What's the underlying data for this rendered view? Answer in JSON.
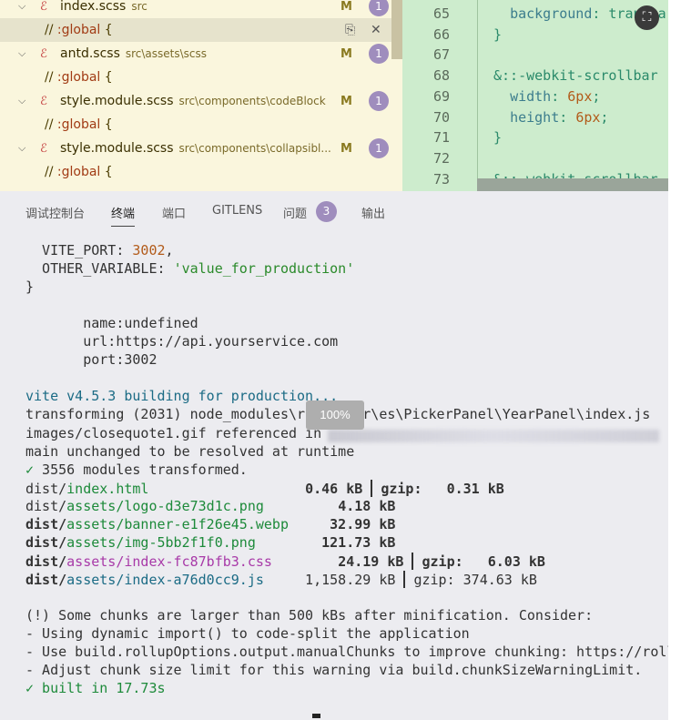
{
  "search_results": {
    "rows": [
      {
        "type": "file",
        "name": "index.scss",
        "path": "src",
        "badge": "M",
        "count": "1"
      },
      {
        "type": "match",
        "text": "// ",
        "highlight": ":global",
        "after": " {"
      },
      {
        "type": "file",
        "name": "antd.scss",
        "path": "src\\assets\\scss",
        "badge": "M",
        "count": "1"
      },
      {
        "type": "match",
        "text": "// ",
        "highlight": ":global",
        "after": " {"
      },
      {
        "type": "file",
        "name": "style.module.scss",
        "path": "src\\components\\codeBlock",
        "badge": "M",
        "count": "1"
      },
      {
        "type": "match",
        "text": "// ",
        "highlight": ":global",
        "after": " {"
      },
      {
        "type": "file",
        "name": "style.module.scss",
        "path": "src\\components\\collapsibl...",
        "badge": "M",
        "count": "1"
      },
      {
        "type": "match",
        "text": "// ",
        "highlight": ":global",
        "after": " {"
      }
    ],
    "icons": {
      "chevron": "chevron-down-icon",
      "file": "scss-file-icon",
      "replace": "replace-icon",
      "dismiss": "close-icon"
    }
  },
  "code_editor": {
    "lines": [
      {
        "num": "65",
        "parts": [
          {
            "t": "  "
          },
          {
            "t": "background",
            "c": "k"
          },
          {
            "t": ": transpa"
          }
        ]
      },
      {
        "num": "66",
        "parts": [
          {
            "t": "}"
          }
        ]
      },
      {
        "num": "67",
        "parts": [
          {
            "t": ""
          }
        ]
      },
      {
        "num": "68",
        "parts": [
          {
            "t": "&::-webkit-scrollbar "
          }
        ]
      },
      {
        "num": "69",
        "parts": [
          {
            "t": "  "
          },
          {
            "t": "width",
            "c": "k"
          },
          {
            "t": ": "
          },
          {
            "t": "6px",
            "c": "n"
          },
          {
            "t": ";"
          }
        ]
      },
      {
        "num": "70",
        "parts": [
          {
            "t": "  "
          },
          {
            "t": "height",
            "c": "k"
          },
          {
            "t": ": "
          },
          {
            "t": "6px",
            "c": "n"
          },
          {
            "t": ";"
          }
        ]
      },
      {
        "num": "71",
        "parts": [
          {
            "t": "}"
          }
        ]
      },
      {
        "num": "72",
        "parts": [
          {
            "t": ""
          }
        ]
      },
      {
        "num": "73",
        "parts": [
          {
            "t": "&::-webkit-scrollbar-"
          }
        ]
      }
    ]
  },
  "fullscreen_icon": "fullscreen-exit-icon",
  "panel_tabs": [
    {
      "id": "debug-console",
      "label": "调试控制台"
    },
    {
      "id": "terminal",
      "label": "终端",
      "active": true
    },
    {
      "id": "ports",
      "label": "端口"
    },
    {
      "id": "gitlens",
      "label": "GITLENS"
    },
    {
      "id": "problems",
      "label": "问题",
      "badge": "3"
    },
    {
      "id": "output",
      "label": "输出"
    }
  ],
  "zoom_tooltip": "100%",
  "terminal": {
    "lines": [
      [
        {
          "t": "  VITE_PORT: "
        },
        {
          "t": "3002",
          "c": "num"
        },
        {
          "t": ","
        }
      ],
      [
        {
          "t": "  OTHER_VARIABLE: "
        },
        {
          "t": "'value_for_production'",
          "c": "str"
        }
      ],
      [
        {
          "t": "}"
        }
      ],
      [
        {
          "t": ""
        }
      ],
      [
        {
          "t": "       name:undefined"
        }
      ],
      [
        {
          "t": "       url:https://api.yourservice.com"
        }
      ],
      [
        {
          "t": "       port:3002"
        }
      ],
      [
        {
          "t": ""
        }
      ],
      [
        {
          "t": "vite v4.5.3 building for production...",
          "c": "cyan"
        }
      ],
      [
        {
          "t": "transforming (2031) node_modules\\rc-picker\\es\\PickerPanel\\YearPanel\\index.js"
        }
      ],
      [
        {
          "t": "images/closequote1.gif referenced in "
        }
      ],
      [
        {
          "t": "main unchanged to be resolved at runtime"
        }
      ],
      [
        {
          "t": "✓",
          "c": "green"
        },
        {
          "t": " 3556 modules transformed."
        }
      ],
      [
        {
          "t": "dist/"
        },
        {
          "t": "index.html",
          "c": "green"
        },
        {
          "t": "                   "
        },
        {
          "t": "0.46 kB",
          "c": "b"
        },
        {
          "t": " "
        },
        {
          "sep": true
        },
        {
          "t": " "
        },
        {
          "t": "gzip:   0.31 kB",
          "c": "b"
        }
      ],
      [
        {
          "t": "dist/"
        },
        {
          "t": "assets/logo-d3e73d1c.png",
          "c": "green"
        },
        {
          "t": "         "
        },
        {
          "t": "4.18 kB",
          "c": "b"
        }
      ],
      [
        {
          "t": "dist/",
          "c": "b"
        },
        {
          "t": "assets/banner-e1f26e45.webp",
          "c": "green"
        },
        {
          "t": "     "
        },
        {
          "t": "32.99 kB",
          "c": "b"
        }
      ],
      [
        {
          "t": "dist/",
          "c": "b"
        },
        {
          "t": "assets/img-5bb2f1f0.png",
          "c": "green"
        },
        {
          "t": "        "
        },
        {
          "t": "121.73 kB",
          "c": "b"
        }
      ],
      [
        {
          "t": "dist/",
          "c": "b"
        },
        {
          "t": "assets/index-fc87bfb3.css",
          "c": "magenta"
        },
        {
          "t": "        "
        },
        {
          "t": "24.19 kB",
          "c": "b"
        },
        {
          "t": " "
        },
        {
          "sep": true
        },
        {
          "t": " "
        },
        {
          "t": "gzip:   6.03 kB",
          "c": "b"
        }
      ],
      [
        {
          "t": "dist/",
          "c": "b"
        },
        {
          "t": "assets/index-a76d0cc9.js",
          "c": "cyan"
        },
        {
          "t": "     1,158.29 kB "
        },
        {
          "sep": true
        },
        {
          "t": " gzip: 374.63 kB"
        }
      ],
      [
        {
          "t": ""
        }
      ],
      [
        {
          "t": "(!) Some chunks are larger than 500 kBs after minification. Consider:"
        }
      ],
      [
        {
          "t": "- Using dynamic import() to code-split the application"
        }
      ],
      [
        {
          "t": "- Use build.rollupOptions.output.manualChunks to improve chunking: https://roll"
        }
      ],
      [
        {
          "t": "- Adjust chunk size limit for this warning via build.chunkSizeWarningLimit."
        }
      ],
      [
        {
          "t": "✓",
          "c": "green"
        },
        {
          "t": " built in 17.73s",
          "c": "green"
        }
      ]
    ]
  }
}
